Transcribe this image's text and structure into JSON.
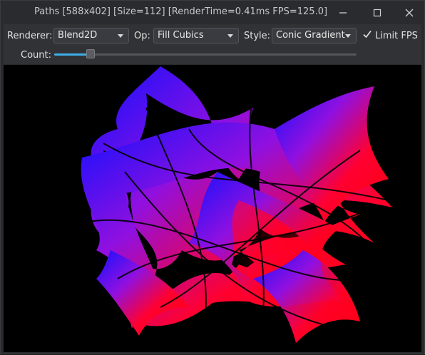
{
  "window": {
    "title": "Paths [588x402] [Size=112] [RenderTime=0.41ms FPS=125.0]"
  },
  "toolbar": {
    "renderer_label": "Renderer:",
    "renderer_value": "Blend2D",
    "op_label": "Op:",
    "op_value": "Fill Cubics",
    "style_label": "Style:",
    "style_value": "Conic Gradient",
    "limit_fps_label": "Limit FPS",
    "limit_fps_checked": true,
    "count_label": "Count:",
    "count_fraction": 0.12
  },
  "canvas": {
    "gradient_colors": [
      "#1010ff",
      "#9010e0",
      "#ff0030",
      "#ff0010"
    ],
    "background": "#000000"
  },
  "icons": {
    "minimize": "minimize-icon",
    "maximize": "maximize-icon",
    "close": "close-icon",
    "checkmark": "checkmark-icon",
    "combo_arrow": "chevron-down-icon"
  }
}
